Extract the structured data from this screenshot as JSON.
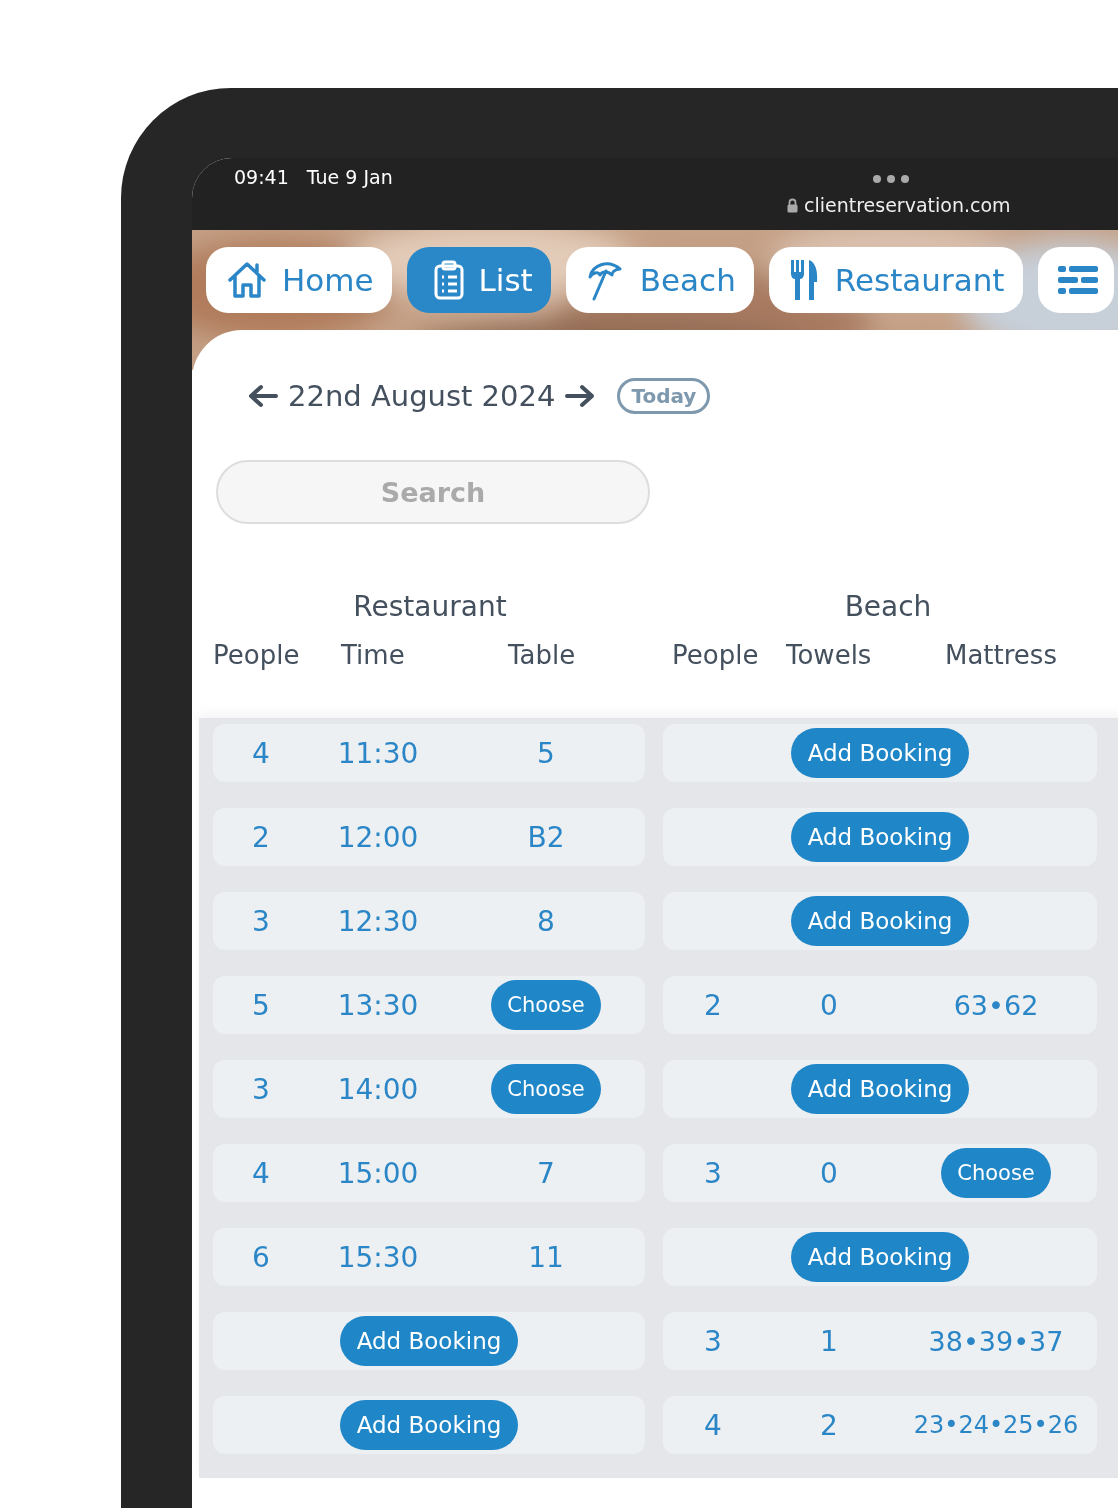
{
  "status_bar": {
    "time": "09:41",
    "date": "Tue 9 Jan",
    "url": "clientreservation.com"
  },
  "nav": [
    {
      "label": "Home",
      "kind": "home",
      "selected": false
    },
    {
      "label": "List",
      "kind": "list",
      "selected": true
    },
    {
      "label": "Beach",
      "kind": "beach",
      "selected": false
    },
    {
      "label": "Restaurant",
      "kind": "restaurant",
      "selected": false
    },
    {
      "kind": "menu",
      "selected": false
    }
  ],
  "date_bar": {
    "date": "22nd August 2024",
    "today": "Today"
  },
  "search": {
    "placeholder": "Search"
  },
  "table": {
    "groups": [
      "Restaurant",
      "Beach"
    ],
    "columns": [
      "People",
      "Time",
      "Table",
      "People",
      "Towels",
      "Mattress"
    ],
    "rows": [
      {
        "restaurant": {
          "kind": "booking",
          "people": "4",
          "time": "11:30",
          "table": {
            "kind": "text",
            "text": "5"
          }
        },
        "beach": {
          "kind": "empty",
          "action": "Add Booking"
        }
      },
      {
        "restaurant": {
          "kind": "booking",
          "people": "2",
          "time": "12:00",
          "table": {
            "kind": "text",
            "text": "B2"
          }
        },
        "beach": {
          "kind": "empty",
          "action": "Add Booking"
        }
      },
      {
        "restaurant": {
          "kind": "booking",
          "people": "3",
          "time": "12:30",
          "table": {
            "kind": "text",
            "text": "8"
          }
        },
        "beach": {
          "kind": "empty",
          "action": "Add Booking"
        }
      },
      {
        "restaurant": {
          "kind": "booking",
          "people": "5",
          "time": "13:30",
          "table": {
            "kind": "button",
            "text": "Choose"
          }
        },
        "beach": {
          "kind": "booking",
          "people": "2",
          "towels": "0",
          "mattress": {
            "kind": "text",
            "text": "63•62"
          }
        }
      },
      {
        "restaurant": {
          "kind": "booking",
          "people": "3",
          "time": "14:00",
          "table": {
            "kind": "button",
            "text": "Choose"
          }
        },
        "beach": {
          "kind": "empty",
          "action": "Add Booking"
        }
      },
      {
        "restaurant": {
          "kind": "booking",
          "people": "4",
          "time": "15:00",
          "table": {
            "kind": "text",
            "text": "7"
          }
        },
        "beach": {
          "kind": "booking",
          "people": "3",
          "towels": "0",
          "mattress": {
            "kind": "button",
            "text": "Choose"
          }
        }
      },
      {
        "restaurant": {
          "kind": "booking",
          "people": "6",
          "time": "15:30",
          "table": {
            "kind": "text",
            "text": "11"
          }
        },
        "beach": {
          "kind": "empty",
          "action": "Add Booking"
        }
      },
      {
        "restaurant": {
          "kind": "empty",
          "action": "Add Booking"
        },
        "beach": {
          "kind": "booking",
          "people": "3",
          "towels": "1",
          "mattress": {
            "kind": "text",
            "text": "38•39•37"
          }
        }
      },
      {
        "restaurant": {
          "kind": "empty",
          "action": "Add Booking"
        },
        "beach": {
          "kind": "booking",
          "people": "4",
          "towels": "2",
          "mattress": {
            "kind": "text",
            "text": "23•24•25•26"
          }
        }
      }
    ]
  }
}
